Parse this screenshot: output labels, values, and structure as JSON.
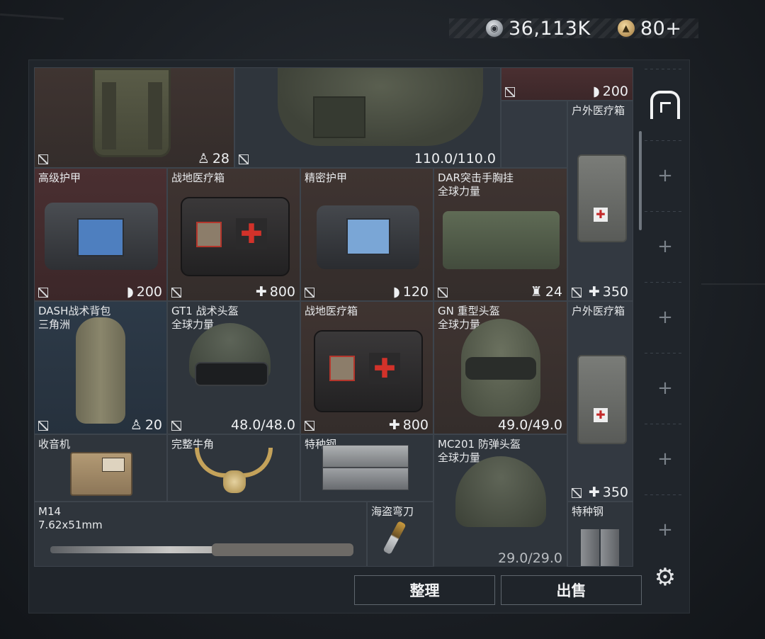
{
  "currency": {
    "silver_icon": "silver-coin-icon",
    "silver_amount": "36,113K",
    "gold_icon": "gold-coin-icon",
    "gold_amount": "80+"
  },
  "items": {
    "top_backpack_stat": "28",
    "top_vest_stat": "110.0/110.0",
    "top_right_stat": "200",
    "outdoor_med_1_name": "户外医疗箱",
    "outdoor_med_1_stat": "350",
    "adv_armor_name": "高级护甲",
    "adv_armor_stat": "200",
    "field_med_1_name": "战地医疗箱",
    "field_med_1_stat": "800",
    "precise_armor_name": "精密护甲",
    "precise_armor_stat": "120",
    "dar_name": "DAR突击手胸挂",
    "dar_sub": "全球力量",
    "dar_stat": "24",
    "dash_name": "DASH战术背包",
    "dash_sub": "三角洲",
    "dash_stat": "20",
    "gt1_name": "GT1 战术头盔",
    "gt1_sub": "全球力量",
    "gt1_stat": "48.0/48.0",
    "field_med_2_name": "战地医疗箱",
    "field_med_2_stat": "800",
    "gn_name": "GN 重型头盔",
    "gn_sub": "全球力量",
    "gn_stat": "49.0/49.0",
    "outdoor_med_2_name": "户外医疗箱",
    "outdoor_med_2_stat": "350",
    "radio_name": "收音机",
    "horn_name": "完整牛角",
    "steel_1_name": "特种钢",
    "mc201_name": "MC201 防弹头盔",
    "mc201_sub": "全球力量",
    "mc201_stat": "29.0/29.0",
    "m14_name": "M14",
    "m14_sub": "7.62x51mm",
    "pirate_name": "海盗弯刀",
    "steel_2_name": "特种钢"
  },
  "buttons": {
    "sort_label": "整理",
    "sell_label": "出售"
  },
  "sidebar": {
    "plus_label": "+"
  }
}
